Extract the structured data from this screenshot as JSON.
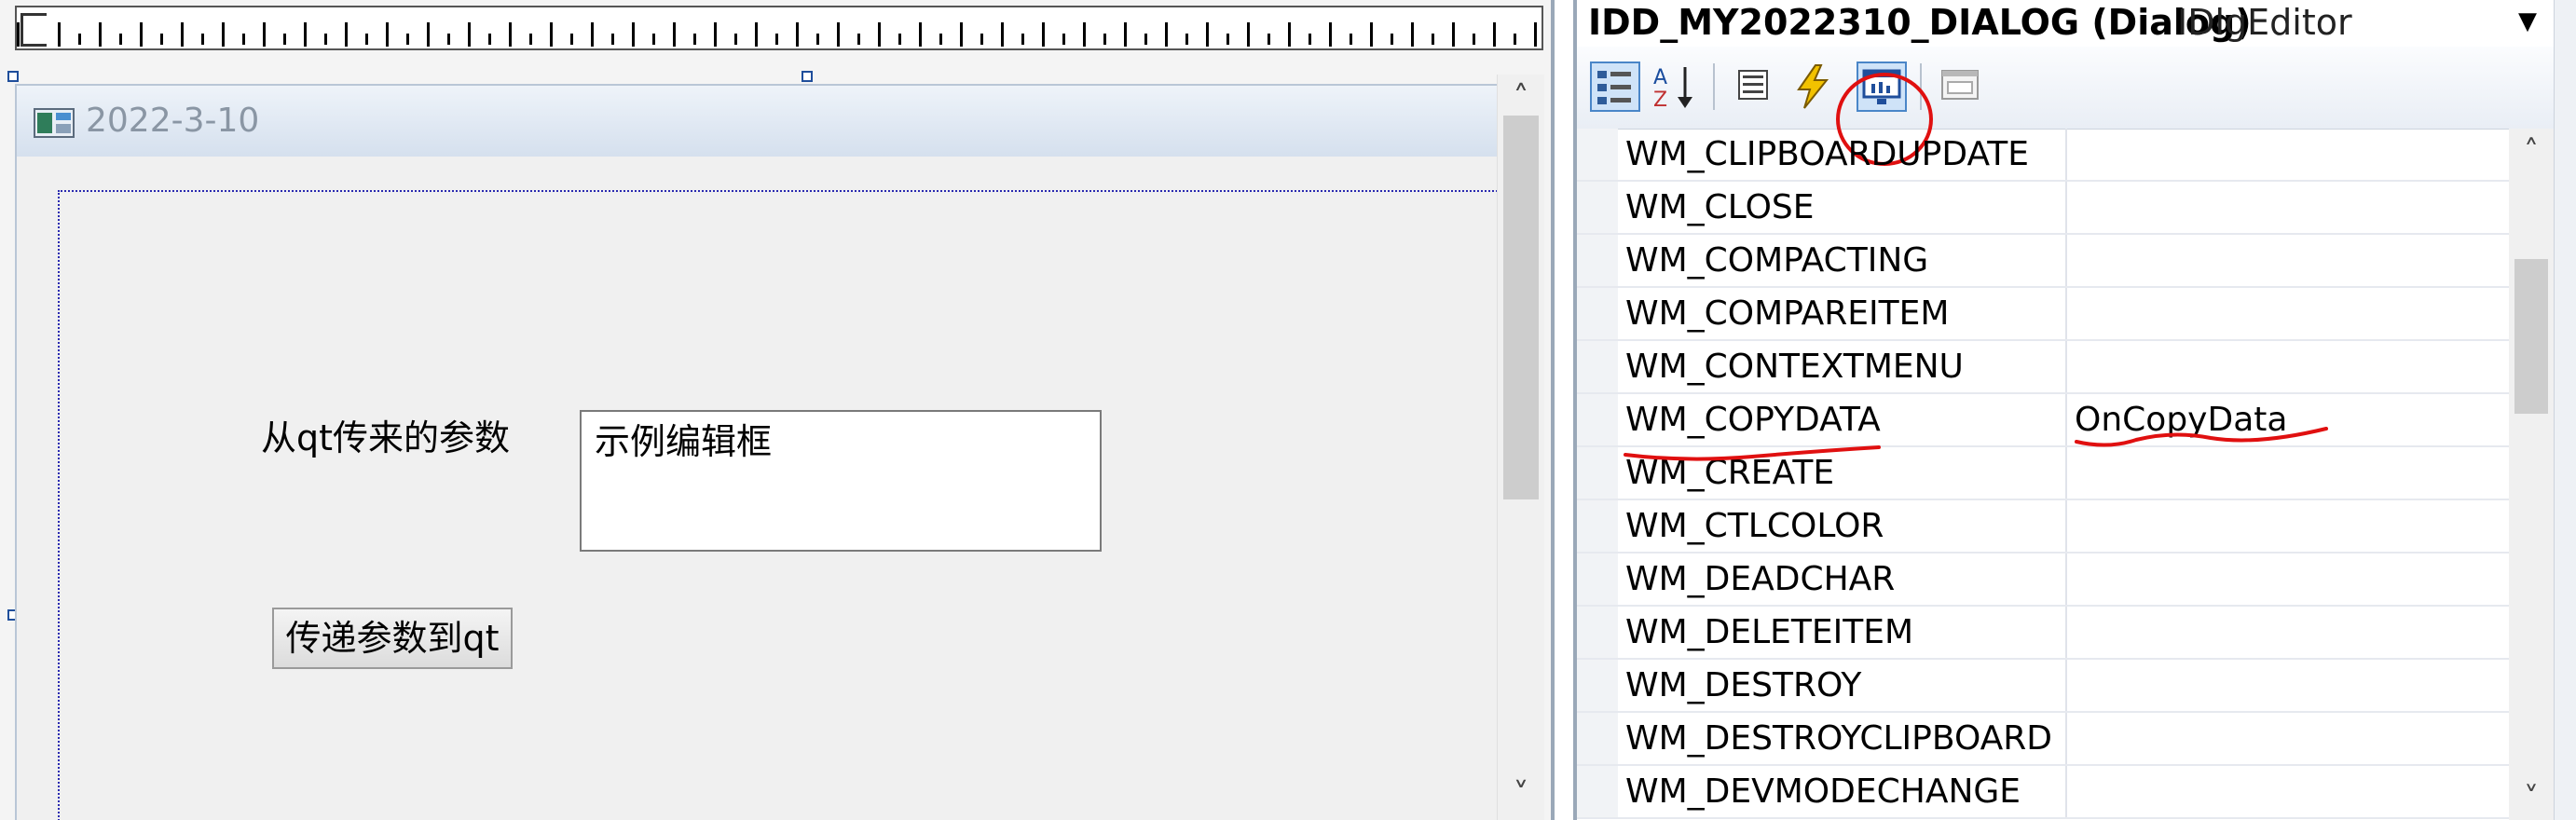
{
  "designer": {
    "dialog_title": "2022-3-10",
    "label_text": "从qt传来的参数",
    "edit_text": "示例编辑框",
    "button_text": "传递参数到qt"
  },
  "properties": {
    "object_name": "IDD_MY2022310_DIALOG (Dialog)",
    "object_class": "IDlgEditor",
    "toolbar": [
      {
        "name": "categorized-icon",
        "glyph": "▤"
      },
      {
        "name": "alphabetical-icon",
        "glyph": "A↓"
      },
      {
        "name": "properties-icon",
        "glyph": "☰"
      },
      {
        "name": "events-icon",
        "glyph": "⚡"
      },
      {
        "name": "messages-icon",
        "glyph": "▣"
      },
      {
        "name": "overrides-icon",
        "glyph": "▭"
      }
    ],
    "messages": [
      {
        "name": "WM_CLIPBOARDUPDATE",
        "handler": ""
      },
      {
        "name": "WM_CLOSE",
        "handler": ""
      },
      {
        "name": "WM_COMPACTING",
        "handler": ""
      },
      {
        "name": "WM_COMPAREITEM",
        "handler": ""
      },
      {
        "name": "WM_CONTEXTMENU",
        "handler": ""
      },
      {
        "name": "WM_COPYDATA",
        "handler": "OnCopyData"
      },
      {
        "name": "WM_CREATE",
        "handler": ""
      },
      {
        "name": "WM_CTLCOLOR",
        "handler": ""
      },
      {
        "name": "WM_DEADCHAR",
        "handler": ""
      },
      {
        "name": "WM_DELETEITEM",
        "handler": ""
      },
      {
        "name": "WM_DESTROY",
        "handler": ""
      },
      {
        "name": "WM_DESTROYCLIPBOARD",
        "handler": ""
      },
      {
        "name": "WM_DEVMODECHANGE",
        "handler": ""
      }
    ]
  },
  "colors": {
    "annotation_red": "#e01010",
    "dotted_border": "#2a2ab0"
  }
}
